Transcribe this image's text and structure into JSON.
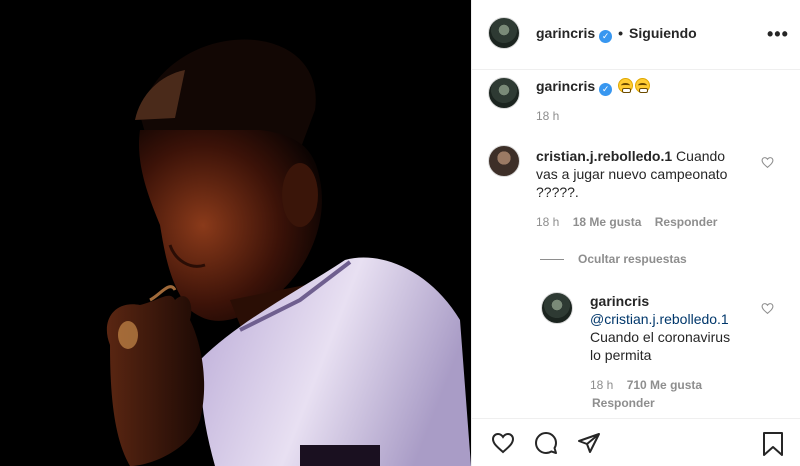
{
  "post": {
    "author": "garincris",
    "follow_status": "Siguiendo",
    "caption_time": "18 h"
  },
  "comments": [
    {
      "user": "cristian.j.rebolledo.1",
      "text_line1": "Cuando",
      "text_line2": "vas a jugar nuevo campeonato",
      "text_line3": "?????.",
      "time": "18 h",
      "likes": "18 Me gusta",
      "reply_label": "Responder"
    }
  ],
  "thread": {
    "toggle_label": "Ocultar respuestas"
  },
  "reply": {
    "user": "garincris",
    "mention": "@cristian.j.rebolledo.1",
    "text_line1": "Cuando el coronavirus",
    "text_line2": "lo permita",
    "time": "18 h",
    "likes": "710 Me gusta",
    "reply_label": "Responder"
  },
  "icons": {
    "more": "more-options-icon",
    "verified": "verified-badge-icon",
    "like": "heart-icon",
    "comment": "comment-icon",
    "share": "share-icon",
    "save": "bookmark-icon"
  },
  "colors": {
    "verified": "#3897f0",
    "muted": "#8e8e8e",
    "mention": "#00376b"
  }
}
